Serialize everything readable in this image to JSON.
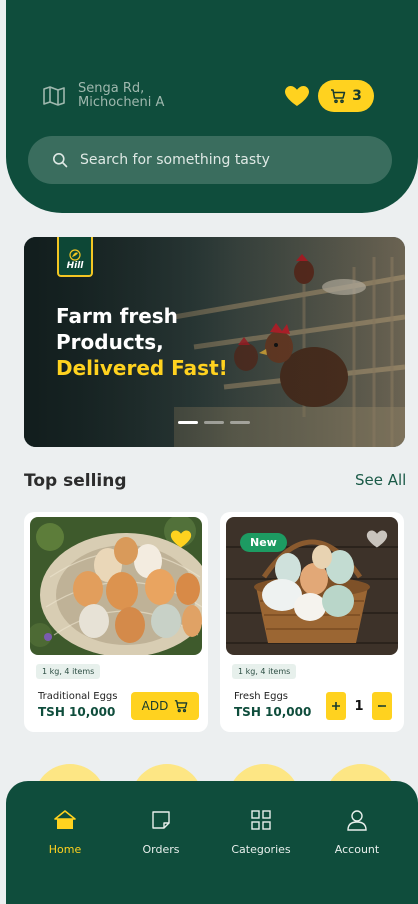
{
  "header": {
    "location_line1": "Senga Rd,",
    "location_line2": "Michocheni A",
    "cart_count": "3",
    "search_placeholder": "Search for something tasty"
  },
  "banner": {
    "logo_text": "Hill",
    "line1": "Farm fresh",
    "line2": "Products,",
    "line3": "Delivered Fast!",
    "slides": 3,
    "active_slide": 1
  },
  "top_selling": {
    "title": "Top selling",
    "see_all": "See All",
    "products": [
      {
        "name": "Traditional Eggs",
        "qty": "1 kg, 4 items",
        "price": "TSH 10,000",
        "action": "ADD",
        "favorited": true
      },
      {
        "name": "Fresh Eggs",
        "qty": "1 kg, 4 items",
        "price": "TSH 10,000",
        "badge": "New",
        "quantity": "1",
        "favorited": false
      }
    ]
  },
  "nav": {
    "items": [
      {
        "label": "Home",
        "icon": "home-icon",
        "active": true
      },
      {
        "label": "Orders",
        "icon": "orders-icon",
        "active": false
      },
      {
        "label": "Categories",
        "icon": "categories-icon",
        "active": false
      },
      {
        "label": "Account",
        "icon": "account-icon",
        "active": false
      }
    ]
  },
  "colors": {
    "brand_green": "#0f4d3c",
    "accent_yellow": "#ffd21f",
    "badge_green": "#1d9b62"
  }
}
